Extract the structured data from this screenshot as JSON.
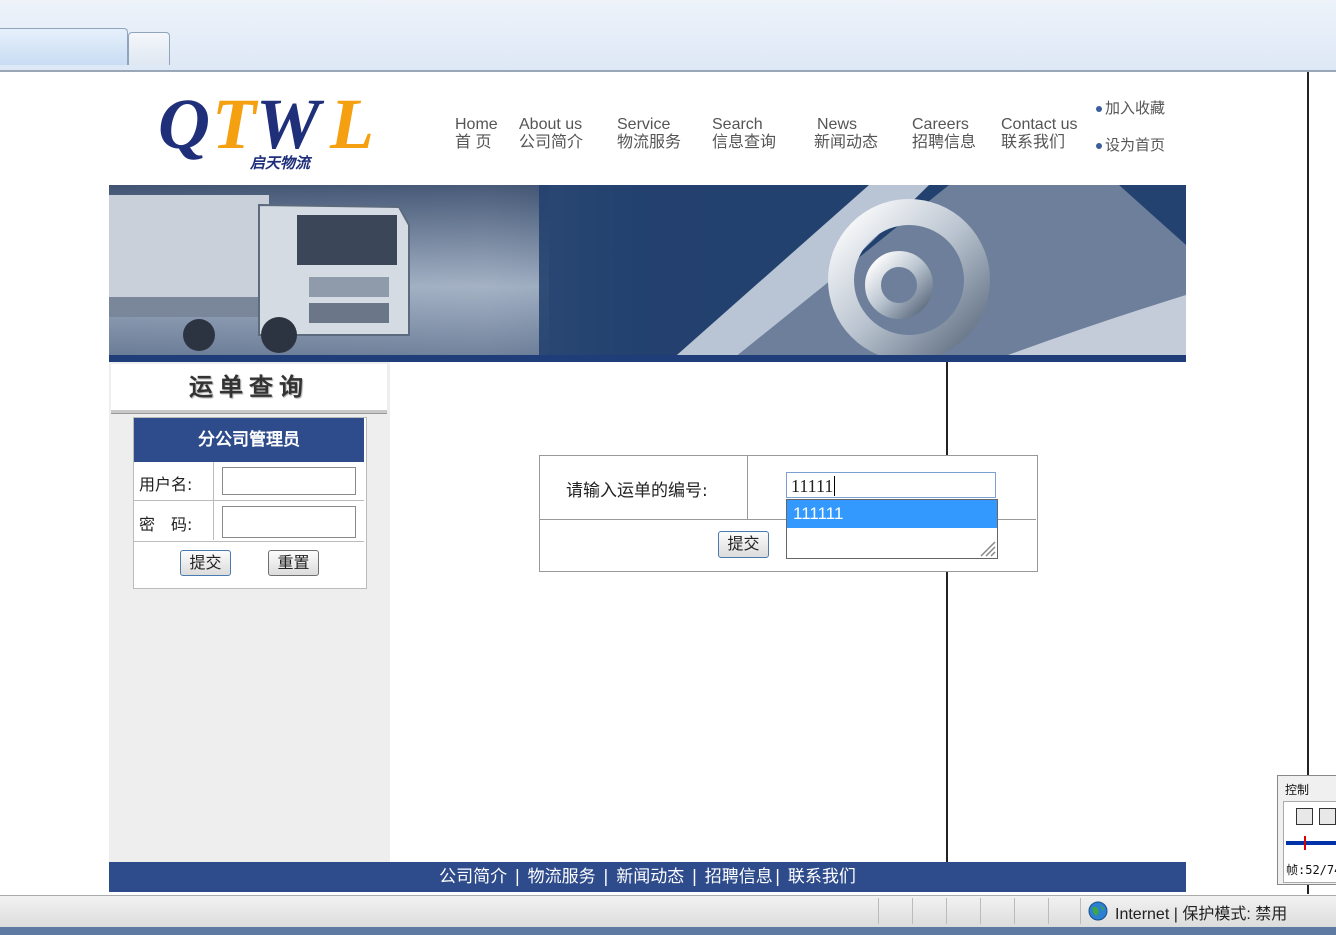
{
  "header": {
    "logo_text": "QTWL",
    "logo_sub": "启天物流",
    "nav": [
      {
        "en": "Home",
        "cn": "首 页"
      },
      {
        "en": "About us",
        "cn": "公司简介"
      },
      {
        "en": "Service",
        "cn": "物流服务"
      },
      {
        "en": "Search",
        "cn": "信息查询"
      },
      {
        "en": "News",
        "cn": "新闻动态"
      },
      {
        "en": "Careers",
        "cn": "招聘信息"
      },
      {
        "en": "Contact us",
        "cn": "联系我们"
      }
    ],
    "add_favorite": "加入收藏",
    "set_homepage": "设为首页"
  },
  "sidebar": {
    "title": "运单查询",
    "login": {
      "heading": "分公司管理员",
      "username_label": "用户名:",
      "password_label": "密　码:",
      "submit_label": "提交",
      "reset_label": "重置"
    }
  },
  "query": {
    "label": "请输入运单的编号:",
    "input_value": "11111",
    "suggestion": "111111",
    "submit_label": "提交"
  },
  "footer": {
    "links": [
      "公司简介",
      "物流服务",
      "新闻动态",
      "招聘信息",
      "联系我们"
    ]
  },
  "statusbar": {
    "zone": "Internet",
    "protected_mode": "保护模式: 禁用"
  },
  "control_panel": {
    "title": "控制",
    "frame": "帧:52/74"
  },
  "colors": {
    "brand_blue": "#2e4b8c",
    "logo_orange": "#f5a010",
    "highlight": "#3399ff"
  }
}
